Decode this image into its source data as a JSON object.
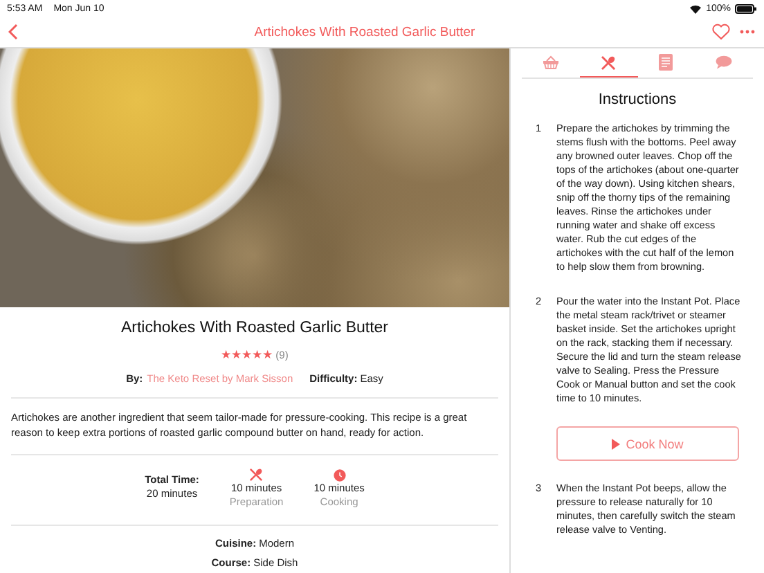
{
  "status_bar": {
    "time": "5:53 AM",
    "date": "Mon Jun 10",
    "battery": "100%"
  },
  "nav": {
    "title": "Artichokes With Roasted Garlic Butter"
  },
  "recipe": {
    "title": "Artichokes With Roasted Garlic Butter",
    "stars": 5,
    "rating_count": "(9)",
    "by_label": "By:",
    "author": "The Keto Reset by Mark Sisson",
    "difficulty_label": "Difficulty:",
    "difficulty": "Easy",
    "description": "Artichokes are another ingredient that seem tailor-made for pressure-cooking. This recipe is a great reason to keep extra portions of roasted garlic compound butter on hand, ready for action.",
    "total_label": "Total Time:",
    "total_value": "20 minutes",
    "times": [
      {
        "kind": "prep",
        "value": "10 minutes",
        "label": "Preparation"
      },
      {
        "kind": "cook",
        "value": "10 minutes",
        "label": "Cooking"
      }
    ],
    "meta": [
      {
        "label": "Cuisine:",
        "value": "Modern"
      },
      {
        "label": "Course:",
        "value": "Side Dish"
      }
    ]
  },
  "tabs": [
    {
      "kind": "basket",
      "selected": false
    },
    {
      "kind": "utensils",
      "selected": true
    },
    {
      "kind": "document",
      "selected": false
    },
    {
      "kind": "chat",
      "selected": false
    }
  ],
  "instructions": {
    "title": "Instructions",
    "steps": [
      {
        "number": "1",
        "text": "Prepare the artichokes by trimming the stems flush with the bottoms. Peel away any browned outer leaves. Chop off the tops of the artichokes (about one-quarter of the way down). Using kitchen shears, snip off the thorny tips of the remaining leaves. Rinse the artichokes under running water and shake off excess water. Rub the cut edges of the artichokes with the cut half of the lemon to help slow them from browning."
      },
      {
        "number": "2",
        "text": "Pour the water into the Instant Pot. Place the metal steam rack/trivet or steamer basket inside. Set the artichokes upright on the rack, stacking them if necessary. Secure the lid and turn the steam release valve to Sealing. Press the Pressure Cook or Manual button and set the cook time to 10 minutes.",
        "button": "Cook Now"
      },
      {
        "number": "3",
        "text": "When the Instant Pot beeps, allow the pressure to release naturally for 10 minutes, then carefully switch the steam release valve to Venting."
      }
    ]
  }
}
